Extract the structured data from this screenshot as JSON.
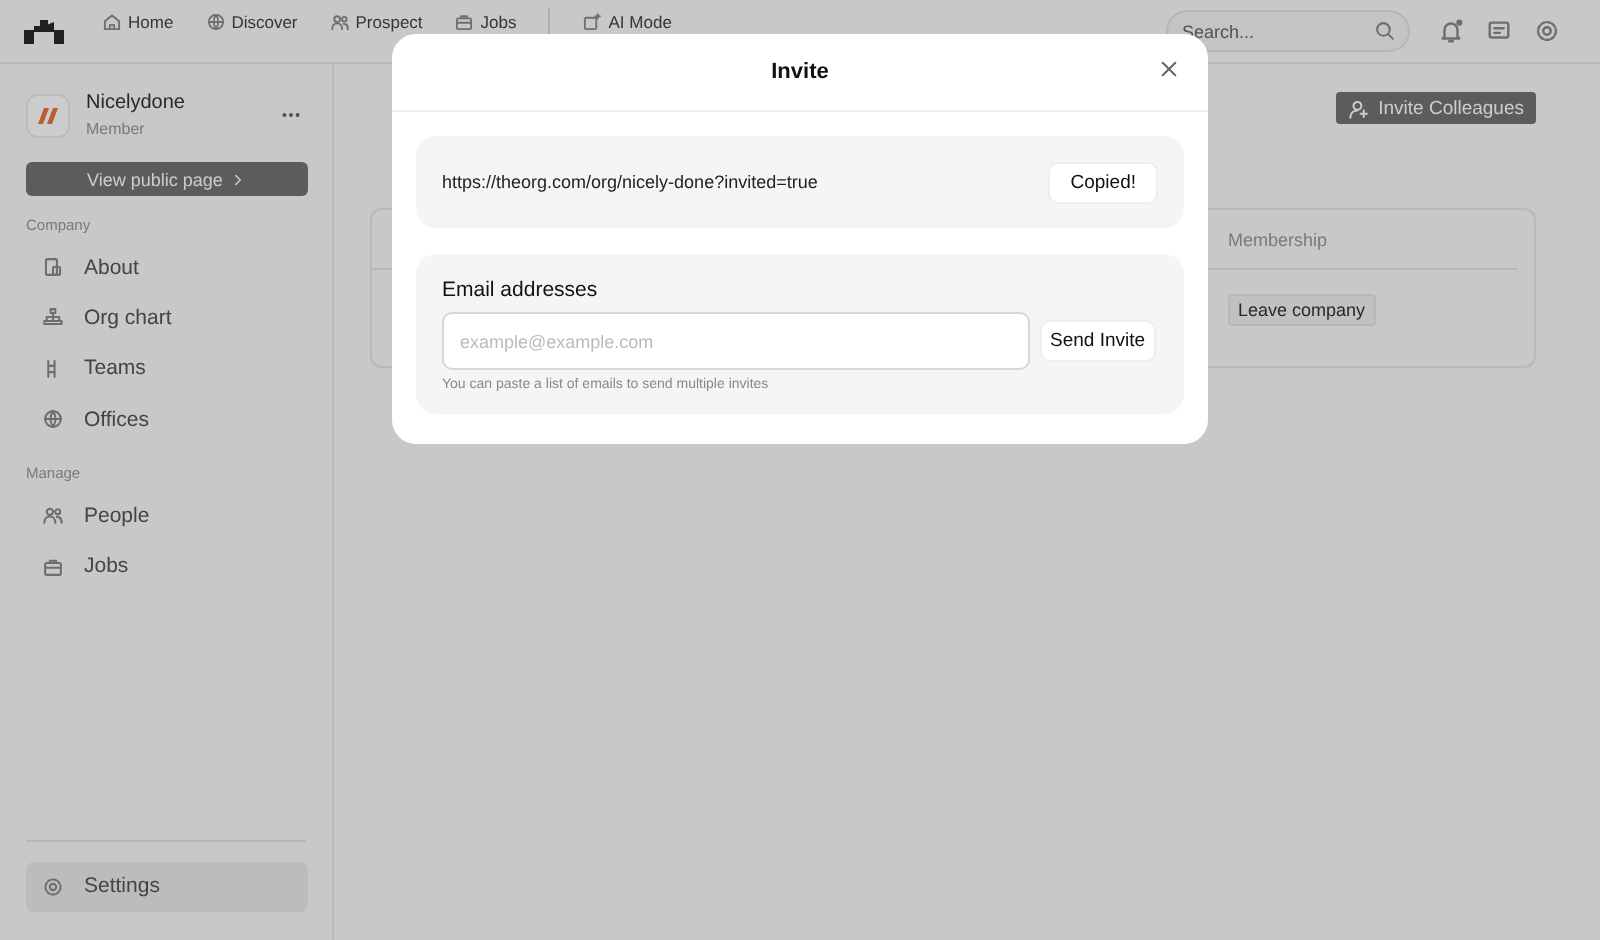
{
  "topnav": {
    "items": [
      {
        "label": "Home"
      },
      {
        "label": "Discover"
      },
      {
        "label": "Prospect"
      },
      {
        "label": "Jobs"
      },
      {
        "label": "AI Mode"
      }
    ],
    "search": {
      "placeholder": "Search..."
    }
  },
  "sidebar": {
    "org": {
      "name": "Nicelydone",
      "role": "Member"
    },
    "view_button": "View public page",
    "sections": [
      {
        "heading": "Company",
        "items": [
          {
            "label": "About",
            "selected": false
          },
          {
            "label": "Org chart",
            "selected": false
          },
          {
            "label": "Teams",
            "selected": false
          },
          {
            "label": "Offices",
            "selected": false
          }
        ]
      },
      {
        "heading": "Manage",
        "items": [
          {
            "label": "People",
            "selected": false
          },
          {
            "label": "Jobs",
            "selected": false
          }
        ]
      }
    ],
    "footer_item": {
      "label": "Settings",
      "selected": true
    }
  },
  "main": {
    "invite_button": "Invite Colleagues",
    "table": {
      "columns": [
        "Membership"
      ],
      "rows": [
        {
          "action": "Leave company"
        }
      ]
    }
  },
  "modal": {
    "title": "Invite",
    "link": "https://theorg.com/org/nicely-done?invited=true",
    "copy_button": "Copied!",
    "email_label": "Email addresses",
    "email_placeholder": "example@example.com",
    "send_button": "Send Invite",
    "hint": "You can paste a list of emails to send multiple invites"
  }
}
